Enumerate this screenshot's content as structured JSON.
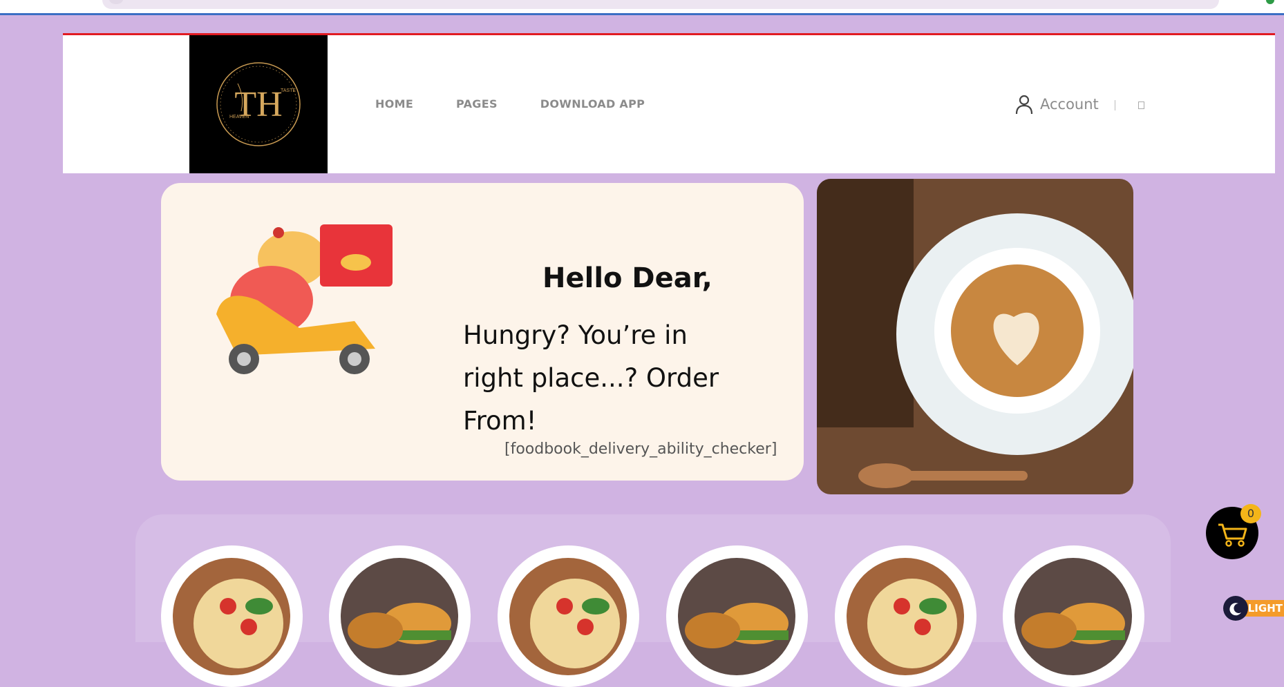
{
  "header": {
    "logo_text": "TH",
    "logo_sub1": "TASTE",
    "logo_sub2": "HEAVEN",
    "nav": [
      "HOME",
      "PAGES",
      "DOWNLOAD APP"
    ],
    "account_label": "Account"
  },
  "hero": {
    "greeting": "Hello Dear,",
    "tagline": "Hungry? You’re in right place...? Order From!",
    "shortcode": "[foodbook_delivery_ability_checker]"
  },
  "cart": {
    "count": "0"
  },
  "mode_toggle": {
    "label": "LIGHT"
  },
  "colors": {
    "accent_red": "#e11b22",
    "page_bg": "#d0b3e2",
    "cart_badge": "#f4b519",
    "toggle": "#f49b2a"
  }
}
